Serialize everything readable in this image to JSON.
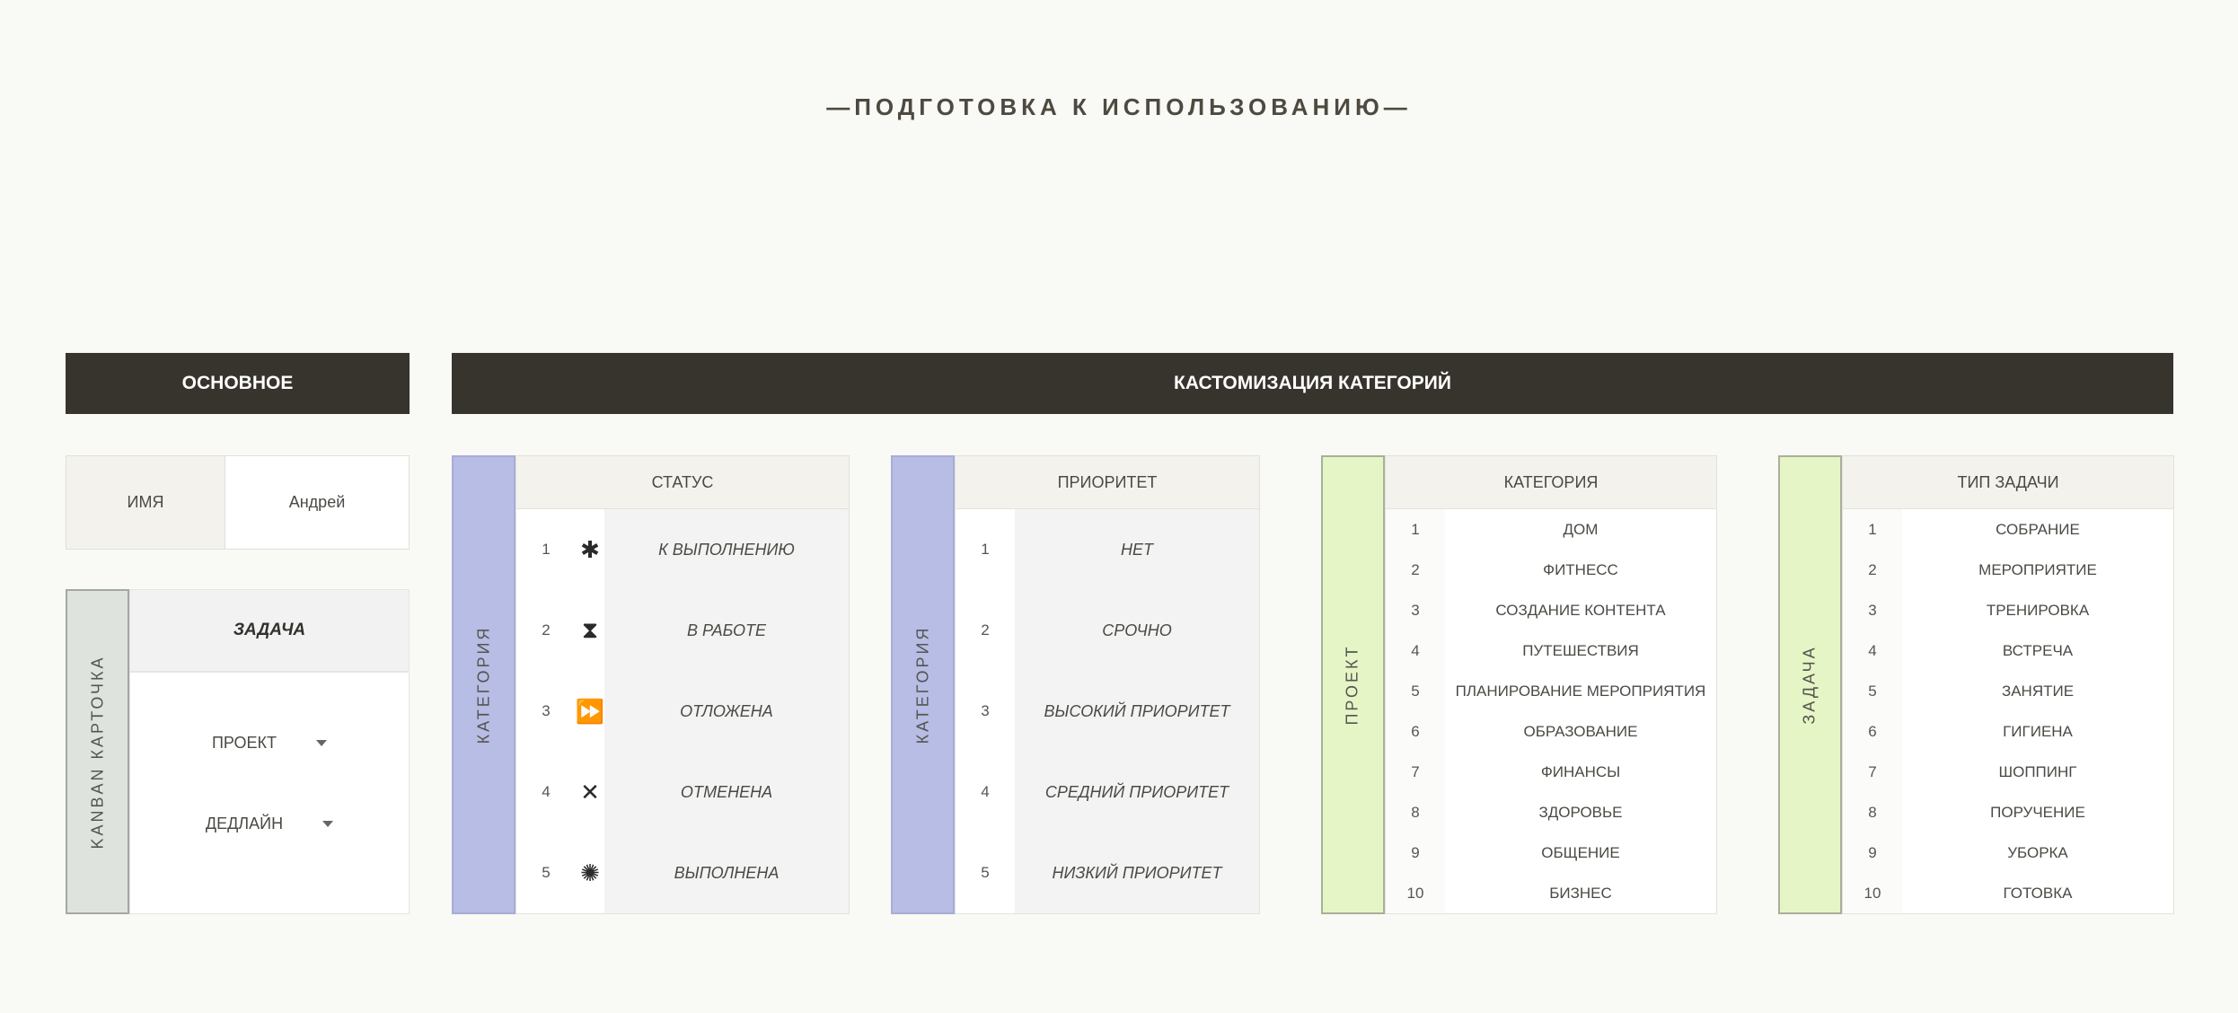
{
  "page_title": "—ПОДГОТОВКА К ИСПОЛЬЗОВАНИЮ—",
  "basic": {
    "header": "ОСНОВНОЕ",
    "name_label": "ИМЯ",
    "name_value": "Андрей",
    "kanban_label": "KANBAN КАРТОЧКА",
    "task_header": "ЗАДАЧА",
    "dropdowns": [
      "ПРОЕКТ",
      "ДЕДЛАЙН"
    ]
  },
  "customization": {
    "header": "КАСТОМИЗАЦИЯ КАТЕГОРИЙ",
    "status": {
      "side_label": "КАТЕГОРИЯ",
      "title": "СТАТУС",
      "items": [
        {
          "num": "1",
          "icon": "asterisk-icon",
          "glyph": "✱",
          "label": "К ВЫПОЛНЕНИЮ"
        },
        {
          "num": "2",
          "icon": "hourglass-icon",
          "glyph": "⧗",
          "label": "В РАБОТЕ"
        },
        {
          "num": "3",
          "icon": "fast-forward-icon",
          "glyph": "⏩",
          "label": "ОТЛОЖЕНА"
        },
        {
          "num": "4",
          "icon": "cross-icon",
          "glyph": "✕",
          "label": "ОТМЕНЕНА"
        },
        {
          "num": "5",
          "icon": "sun-burst-icon",
          "glyph": "✺",
          "label": "ВЫПОЛНЕНА"
        }
      ]
    },
    "priority": {
      "side_label": "КАТЕГОРИЯ",
      "title": "ПРИОРИТЕТ",
      "items": [
        {
          "num": "1",
          "label": "НЕТ"
        },
        {
          "num": "2",
          "label": "СРОЧНО"
        },
        {
          "num": "3",
          "label": "ВЫСОКИЙ ПРИОРИТЕТ"
        },
        {
          "num": "4",
          "label": "СРЕДНИЙ ПРИОРИТЕТ"
        },
        {
          "num": "5",
          "label": "НИЗКИЙ ПРИОРИТЕТ"
        }
      ]
    },
    "category": {
      "side_label": "ПРОЕКТ",
      "title": "КАТЕГОРИЯ",
      "items": [
        {
          "num": "1",
          "label": "ДОМ"
        },
        {
          "num": "2",
          "label": "ФИТНЕСС"
        },
        {
          "num": "3",
          "label": "СОЗДАНИЕ КОНТЕНТА"
        },
        {
          "num": "4",
          "label": "ПУТЕШЕСТВИЯ"
        },
        {
          "num": "5",
          "label": "ПЛАНИРОВАНИЕ МЕРОПРИЯТИЯ"
        },
        {
          "num": "6",
          "label": "ОБРАЗОВАНИЕ"
        },
        {
          "num": "7",
          "label": "ФИНАНСЫ"
        },
        {
          "num": "8",
          "label": "ЗДОРОВЬЕ"
        },
        {
          "num": "9",
          "label": "ОБЩЕНИЕ"
        },
        {
          "num": "10",
          "label": "БИЗНЕС"
        }
      ]
    },
    "task_type": {
      "side_label": "ЗАДАЧА",
      "title": "ТИП ЗАДАЧИ",
      "items": [
        {
          "num": "1",
          "label": "СОБРАНИЕ"
        },
        {
          "num": "2",
          "label": "МЕРОПРИЯТИЕ"
        },
        {
          "num": "3",
          "label": "ТРЕНИРОВКА"
        },
        {
          "num": "4",
          "label": "ВСТРЕЧА"
        },
        {
          "num": "5",
          "label": "ЗАНЯТИЕ"
        },
        {
          "num": "6",
          "label": "ГИГИЕНА"
        },
        {
          "num": "7",
          "label": "ШОППИНГ"
        },
        {
          "num": "8",
          "label": "ПОРУЧЕНИЕ"
        },
        {
          "num": "9",
          "label": "УБОРКА"
        },
        {
          "num": "10",
          "label": "ГОТОВКА"
        }
      ]
    }
  },
  "colors": {
    "header_bg": "#37332d",
    "status_side": "#b7bde4",
    "project_side": "#e6f5c6",
    "kanban_side": "#dfe3de"
  }
}
